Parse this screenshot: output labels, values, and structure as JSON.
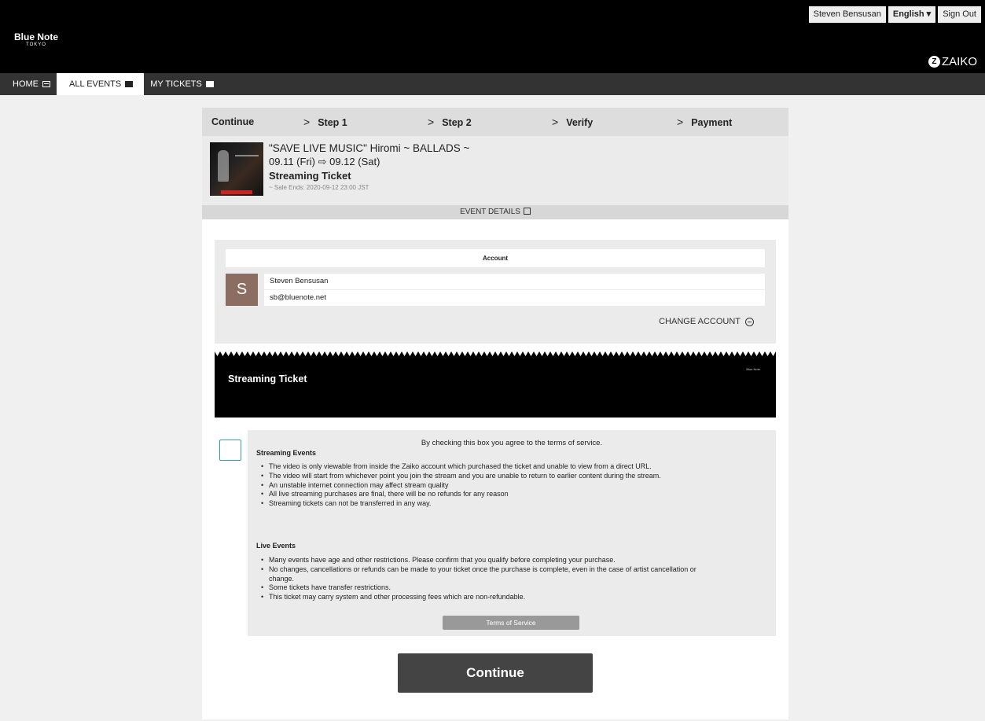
{
  "header": {
    "logo_main": "Blue Note",
    "logo_sub": "TOKYO",
    "user_name": "Steven Bensusan",
    "language": "English ▾",
    "sign_out": "Sign Out",
    "zaiko_mark": "Z",
    "zaiko_label": "ZAIKO"
  },
  "nav": {
    "home": "HOME",
    "all_events": "ALL EVENTS",
    "my_tickets": "MY TICKETS"
  },
  "steps": {
    "continue": "Continue",
    "chevron": ">",
    "step1": "Step 1",
    "step2": "Step 2",
    "verify": "Verify",
    "payment": "Payment"
  },
  "event": {
    "title": "\"SAVE LIVE MUSIC\" Hiromi ~ BALLADS ~",
    "dates": "09.11 (Fri) ⇨ 09.12 (Sat)",
    "ticket_type": "Streaming Ticket",
    "sale_ends": "~ Sale Ends: 2020-09-12 23:00 JST",
    "details_label": "EVENT DETAILS"
  },
  "account": {
    "header": "Account",
    "avatar_initial": "S",
    "name": "Steven Bensusan",
    "email": "sb@bluenote.net",
    "change_label": "CHANGE ACCOUNT"
  },
  "ticket": {
    "label": "Streaming Ticket",
    "mini_logo": "Blue Note"
  },
  "terms": {
    "agree_text": "By checking this box you agree to the terms of service.",
    "streaming_heading": "Streaming Events",
    "streaming_items": [
      "The video is only viewable from inside the Zaiko account which purchased the ticket and unable to view from a direct URL.",
      "The video will start from whichever point you join the stream and you are unable to return to earlier content during the stream.",
      "An unstable internet connection may affect stream quality",
      "All live streaming purchases are final, there will be no refunds for any reason",
      "Streaming tickets can not be transferred in any way."
    ],
    "live_heading": "Live Events",
    "live_items": [
      "Many events have age and other restrictions. Please confirm that you qualify before completing your purchase.",
      "No changes, cancellations or refunds can be made to your ticket once the purchase is complete, even in the case of artist cancellation or",
      "change.",
      "Some tickets have transfer restrictions.",
      "This ticket may carry system and other processing fees which are non-refundable."
    ],
    "tos_button": "Terms of Service"
  },
  "continue_button": "Continue",
  "colors": {
    "checkbox_border": "#3aa090",
    "avatar_bg": "#8b6d62",
    "button_bg": "#444444"
  }
}
